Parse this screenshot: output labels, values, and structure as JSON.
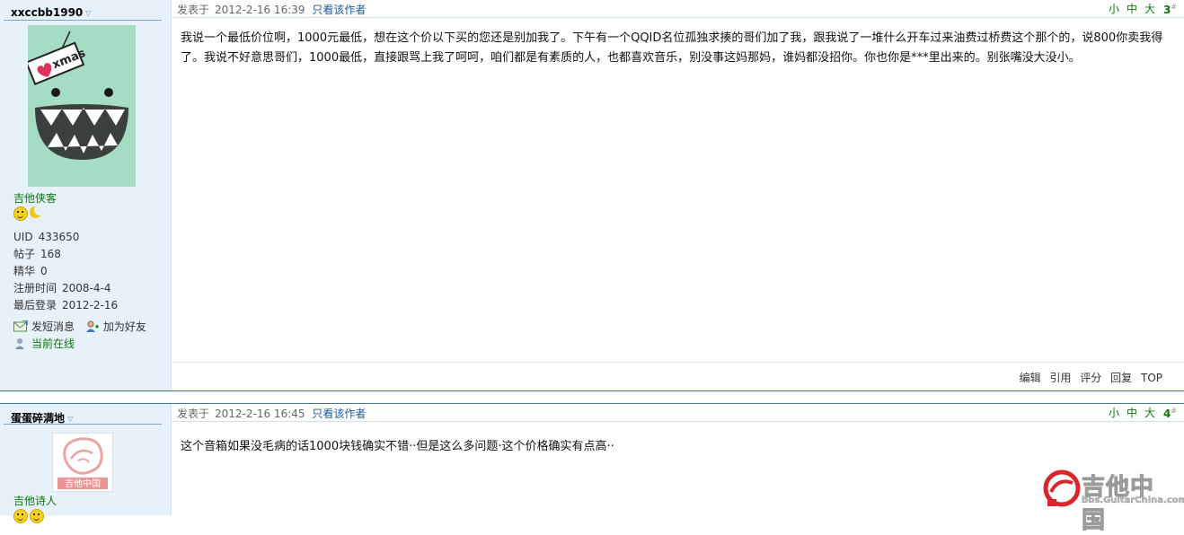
{
  "colors": {
    "accent": "#11730d",
    "link": "#1c5a9e",
    "sidebar_bg": "#e6f1fa",
    "divider": "#2f7aa6"
  },
  "posts": [
    {
      "username": "xxccbb1990",
      "rank": "吉他侠客",
      "rank_icons": [
        "smiley-icon",
        "moon-icon"
      ],
      "stats": [
        {
          "label": "UID",
          "value": "433650"
        },
        {
          "label": "帖子",
          "value": "168"
        },
        {
          "label": "精华",
          "value": "0"
        },
        {
          "label": "注册时间",
          "value": "2008-4-4"
        },
        {
          "label": "最后登录",
          "value": "2012-2-16"
        }
      ],
      "actions": {
        "message": "发短消息",
        "add_friend": "加为好友",
        "online": "当前在线"
      },
      "posted_label": "发表于",
      "time": "2012-2-16 16:39",
      "author_only": "只看该作者",
      "font_sizes": [
        "小",
        "中",
        "大"
      ],
      "floor": "3",
      "floor_mark": "#",
      "content": "我说一个最低价位啊，1000元最低，想在这个价以下买的您还是别加我了。下午有一个QQID名位孤独求揍的哥们加了我，跟我说了一堆什么开车过来油费过桥费这个那个的，说800你卖我得了。我说不好意思哥们，1000最低，直接跟骂上我了呵呵，咱们都是有素质的人，也都喜欢音乐，别没事这妈那妈，谁妈都没招你。你也你是***里出来的。别张嘴没大没小。",
      "footer": [
        "编辑",
        "引用",
        "评分",
        "回复",
        "TOP"
      ]
    },
    {
      "username": "蛋蛋碎满地",
      "rank": "吉他诗人",
      "avatar_text": "吉他中国",
      "posted_label": "发表于",
      "time": "2012-2-16 16:45",
      "author_only": "只看该作者",
      "font_sizes": [
        "小",
        "中",
        "大"
      ],
      "floor": "4",
      "floor_mark": "#",
      "content": "这个音箱如果没毛病的话1000块钱确实不错··但是这么多问题·这个价格确实有点高··"
    }
  ],
  "avatar1_text": "xmas",
  "watermark": {
    "title": "吉他中国",
    "url": "bbs.GuitarChina.com"
  }
}
